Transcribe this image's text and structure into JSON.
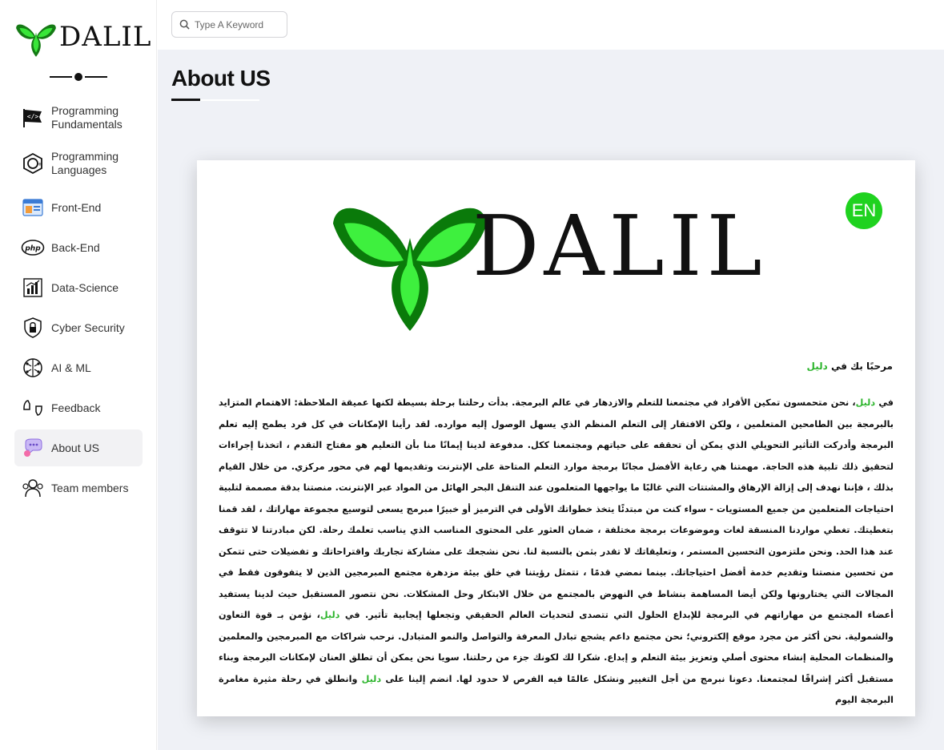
{
  "brand": {
    "name": "DALIL",
    "logo_color": "#39e639"
  },
  "search": {
    "placeholder": "Type A Keyword"
  },
  "sidebar": {
    "items": [
      {
        "label": "Programming Fundamentals",
        "icon": "code-flag-icon"
      },
      {
        "label": "Programming Languages",
        "icon": "c-plus-plus-icon"
      },
      {
        "label": "Front-End",
        "icon": "browser-window-icon"
      },
      {
        "label": "Back-End",
        "icon": "php-icon"
      },
      {
        "label": "Data-Science",
        "icon": "data-chart-icon"
      },
      {
        "label": "Cyber Security",
        "icon": "shield-lock-icon"
      },
      {
        "label": "AI & ML",
        "icon": "brain-circuit-icon"
      },
      {
        "label": "Feedback",
        "icon": "feedback-hands-icon"
      },
      {
        "label": "About US",
        "icon": "chat-bubbles-icon",
        "active": true
      },
      {
        "label": "Team members",
        "icon": "team-icon"
      }
    ]
  },
  "page": {
    "title": "About US"
  },
  "card": {
    "logo_text": "DALIL",
    "lang_toggle": "EN",
    "highlight_color": "#2db52d",
    "greeting_prefix": "مرحبًا بك في ",
    "greeting_name": "دليل",
    "p_seg1": "في ",
    "p_name1": "دليل",
    "p_seg2": "، نحن متحمسون تمكين الأفراد في مجتمعنا للتعلم والازدهار في عالم البرمجة. بدأت رحلتنا برحلة بسيطة لكنها عميقة الملاحظة: الاهتمام المتزايد بالبرمجة بين الطامحين المتعلمين ، ولكن الافتقار إلى التعلم المنظم الذي يسهل الوصول إليه موارده. لقد رأينا الإمكانات في كل فرد يطمح إليه تعلم البرمجة وأدركت التأثير التحويلي الذي يمكن أن تحققه على حياتهم ومجتمعنا ككل. مدفوعة لدينا إيمانًا منا بأن التعليم هو مفتاح التقدم ، اتخذنا إجراءات لتحقيق ذلك تلبية هذه الحاجة. مهمتنا هي رعاية الأفضل مجانًا برمجة موارد التعلم المتاحة على الإنترنت وتقديمها لهم في محور مركزي. من خلال القيام بذلك ، فإننا نهدف إلى إزالة الإرهاق والمشتتات التي غالبًا ما يواجهها المتعلمون عند التنقل البحر الهائل من المواد عبر الإنترنت. منصتنا بدقة مصممة لتلبية احتياجات المتعلمين من جميع المستويات - سواء كنت من مبتدئًا يتخذ خطواتك الأولى في الترميز أو خبيرًا مبرمج يسعى لتوسيع مجموعة مهاراتك ، لقد قمنا بتغطيتك. تغطي مواردنا المنسقة لغات وموضوعات برمجة مختلفة ، ضمان العثور على المحتوى المناسب الذي يناسب تعلمك رحلة. لكن مبادرتنا لا تتوقف عند هذا الحد. ونحن ملتزمون التحسين المستمر ، وتعليقاتك لا تقدر بثمن بالنسبة لنا. نحن نشجعك على مشاركة تجاربك واقتراحاتك و تفضيلات حتى تتمكن من تحسين منصتنا وتقديم خدمة أفضل احتياجاتك. بينما نمضي قدمًا ، تتمثل رؤيتنا في خلق بيئة مزدهرة مجتمع المبرمجين الذين لا يتفوقون فقط في المجالات التي يختارونها ولكن أيضا المساهمة بنشاط في النهوض بالمجتمع من خلال الابتكار وحل المشكلات. نحن نتصور المستقبل حيث لدينا يستفيد أعضاء المجتمع من مهاراتهم في البرمجة للإبداع الحلول التي تتصدى لتحديات العالم الحقيقي وتجعلها إيجابية تأثير. في ",
    "p_name2": "دليل",
    "p_seg3": "، نؤمن بـ قوة التعاون والشمولية. نحن أكثر من مجرد موقع إلكتروني؛ نحن مجتمع داعم يشجع تبادل المعرفة والتواصل والنمو المتبادل. نرحب شراكات مع المبرمجين والمعلمين والمنظمات المحلية إنشاء محتوى أصلي وتعزيز بيئة التعلم و إبداع. شكرا لك لكونك جزء من رحلتنا. سويا نحن يمكن أن تطلق العنان لإمكانات البرمجة وبناء مستقبل أكثر إشراقًا لمجتمعنا. دعونا نبرمج من أجل التغيير ونشكل عالمًا فيه الفرص لا حدود لها. انضم إلينا على ",
    "p_name3": "دليل",
    "p_seg4": " وانطلق في رحلة مثيرة مغامرة البرمجة اليوم"
  }
}
